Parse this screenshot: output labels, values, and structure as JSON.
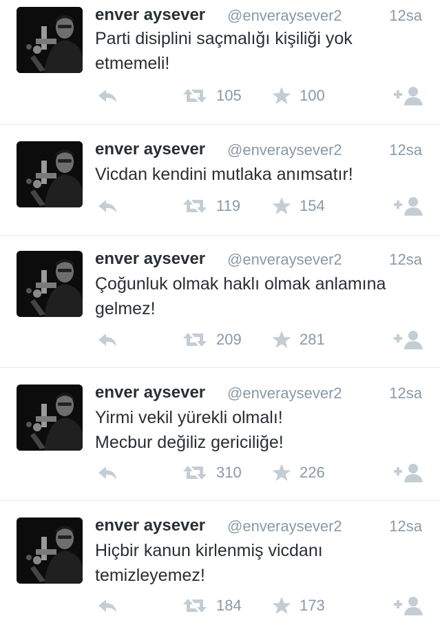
{
  "tweets": [
    {
      "name": "enver aysever",
      "handle": "@enveraysever2",
      "time": "12sa",
      "lines": [
        "Parti disiplini saçmalığı kişiliği yok",
        "etmemeli!"
      ],
      "retweets": "105",
      "favorites": "100"
    },
    {
      "name": "enver aysever",
      "handle": "@enveraysever2",
      "time": "12sa",
      "lines": [
        "Vicdan kendini mutlaka anımsatır!"
      ],
      "retweets": "119",
      "favorites": "154"
    },
    {
      "name": "enver aysever",
      "handle": "@enveraysever2",
      "time": "12sa",
      "lines": [
        "Çoğunluk olmak haklı olmak anlamına",
        "gelmez!"
      ],
      "retweets": "209",
      "favorites": "281"
    },
    {
      "name": "enver aysever",
      "handle": "@enveraysever2",
      "time": "12sa",
      "lines": [
        "Yirmi vekil yürekli olmalı!",
        "Mecbur değiliz gericiliğe!"
      ],
      "retweets": "310",
      "favorites": "226"
    },
    {
      "name": "enver aysever",
      "handle": "@enveraysever2",
      "time": "12sa",
      "lines": [
        "Hiçbir kanun kirlenmiş vicdanı",
        "temizleyemez!"
      ],
      "retweets": "184",
      "favorites": "173"
    }
  ],
  "icons": {
    "reply": "reply-icon",
    "retweet": "retweet-icon",
    "favorite": "star-icon",
    "follow": "follow-icon"
  },
  "colors": {
    "name": "#292f33",
    "meta": "#8899a6",
    "icon": "#c4cdd4",
    "divider": "#e1e8ed"
  }
}
